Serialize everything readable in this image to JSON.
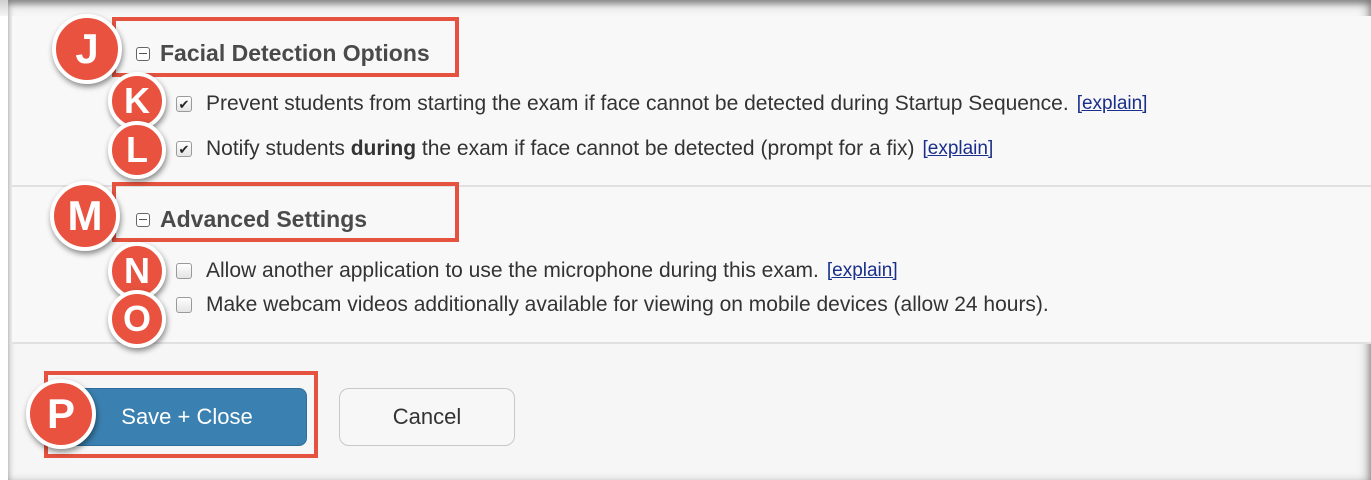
{
  "facial_section": {
    "title": "Facial Detection Options",
    "options": [
      {
        "checked": true,
        "text": "Prevent students from starting the exam if face cannot be detected during Startup Sequence.",
        "link": "[explain]"
      },
      {
        "checked": true,
        "text_before": "Notify students ",
        "text_bold": "during",
        "text_after": " the exam if face cannot be detected (prompt for a fix)",
        "link": "[explain]"
      }
    ]
  },
  "advanced_section": {
    "title": "Advanced Settings",
    "options": [
      {
        "checked": false,
        "text": "Allow another application to use the microphone during this exam.",
        "link": "[explain]"
      },
      {
        "checked": false,
        "text": "Make webcam videos additionally available for viewing on mobile devices (allow 24 hours)."
      }
    ]
  },
  "buttons": {
    "save_label": "Save + Close",
    "cancel_label": "Cancel"
  },
  "badges": {
    "j": "J",
    "k": "K",
    "l": "L",
    "m": "M",
    "n": "N",
    "o": "O",
    "p": "P"
  },
  "colors": {
    "annotation_red": "#e8523f",
    "primary_button": "#3a80b0",
    "link": "#1a2f8a"
  },
  "icons": {
    "collapse": "collapse-minus-icon",
    "check": "checkmark-icon"
  }
}
